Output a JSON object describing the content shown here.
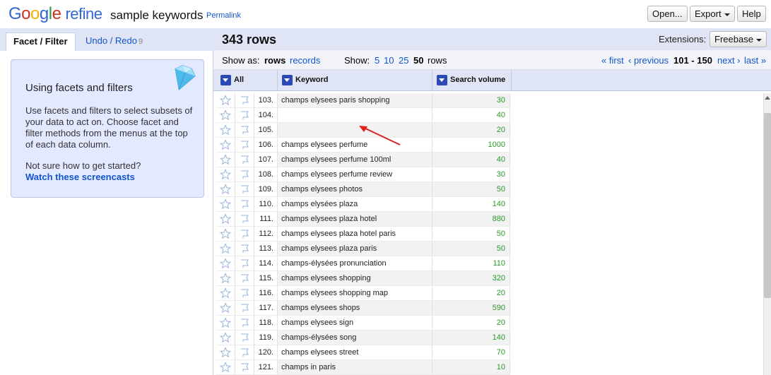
{
  "header": {
    "logo_google": [
      "G",
      "o",
      "o",
      "g",
      "l",
      "e"
    ],
    "logo_refine": "refine",
    "project_name": "sample keywords",
    "permalink": "Permalink",
    "open_label": "Open...",
    "export_label": "Export",
    "help_label": "Help"
  },
  "left_tabs": {
    "facet_filter": "Facet / Filter",
    "undo_redo": "Undo / Redo",
    "undo_count": "9"
  },
  "help_box": {
    "title": "Using facets and filters",
    "description": "Use facets and filters to select subsets of your data to act on. Choose facet and filter methods from the menus at the top of each data column.",
    "question": "Not sure how to get started?",
    "link": "Watch these screencasts",
    "icon": "diamond-icon"
  },
  "summary": {
    "rows_count": "343 rows",
    "extensions_label": "Extensions:",
    "freebase_label": "Freebase"
  },
  "view_bar": {
    "show_as_label": "Show as:",
    "rows": "rows",
    "records": "records",
    "show_label": "Show:",
    "page_sizes": [
      "5",
      "10",
      "25",
      "50"
    ],
    "rows_suffix": "rows",
    "first": "« first",
    "previous": "‹ previous",
    "range": "101 - 150",
    "next": "next ›",
    "last": "last »"
  },
  "columns": {
    "all": "All",
    "keyword": "Keyword",
    "search_volume": "Search volume"
  },
  "rows": [
    {
      "num": "103.",
      "keyword": "champs elysees paris shopping",
      "volume": "30"
    },
    {
      "num": "104.",
      "keyword": "",
      "volume": "40"
    },
    {
      "num": "105.",
      "keyword": "",
      "volume": "20"
    },
    {
      "num": "106.",
      "keyword": "champs elysees perfume",
      "volume": "1000"
    },
    {
      "num": "107.",
      "keyword": "champs elysees perfume 100ml",
      "volume": "40"
    },
    {
      "num": "108.",
      "keyword": "champs elysees perfume review",
      "volume": "30"
    },
    {
      "num": "109.",
      "keyword": "champs elysees photos",
      "volume": "50"
    },
    {
      "num": "110.",
      "keyword": "champs elysées plaza",
      "volume": "140"
    },
    {
      "num": "111.",
      "keyword": "champs elysees plaza hotel",
      "volume": "880"
    },
    {
      "num": "112.",
      "keyword": "champs elysees plaza hotel paris",
      "volume": "50"
    },
    {
      "num": "113.",
      "keyword": "champs elysees plaza paris",
      "volume": "50"
    },
    {
      "num": "114.",
      "keyword": "champs-élysées pronunciation",
      "volume": "110"
    },
    {
      "num": "115.",
      "keyword": "champs elysees shopping",
      "volume": "320"
    },
    {
      "num": "116.",
      "keyword": "champs elysees shopping map",
      "volume": "20"
    },
    {
      "num": "117.",
      "keyword": "champs elysees shops",
      "volume": "590"
    },
    {
      "num": "118.",
      "keyword": "champs elysees sign",
      "volume": "20"
    },
    {
      "num": "119.",
      "keyword": "champs-élysées song",
      "volume": "140"
    },
    {
      "num": "120.",
      "keyword": "champs elysees street",
      "volume": "70"
    },
    {
      "num": "121.",
      "keyword": "champs in paris",
      "volume": "10"
    }
  ],
  "colors": {
    "accent_blue": "#1155cc",
    "header_bg": "#dfe5f4",
    "volume_green": "#2a9a2a",
    "annotation_red": "#e0201c"
  }
}
